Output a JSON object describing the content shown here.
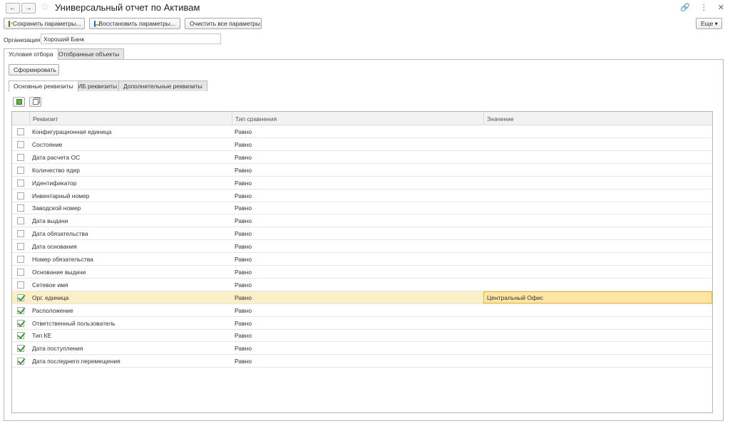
{
  "window": {
    "title": "Универсальный отчет по Активам",
    "back_glyph": "←",
    "forward_glyph": "→",
    "more_label": "Еще ▾"
  },
  "toolbar": {
    "save_label": "Сохранить параметры...",
    "restore_label": "Восстановить параметры...",
    "clear_label": "Очистить все параметры"
  },
  "organization": {
    "label": "Организация:",
    "value": "Хороший Банк"
  },
  "outer_tabs": [
    {
      "label": "Условия отбора"
    },
    {
      "label": "Отобранные объекты"
    }
  ],
  "form_button_label": "Сформировать",
  "inner_tabs": [
    {
      "label": "Основные реквизиты"
    },
    {
      "label": "ИБ реквизиты"
    },
    {
      "label": "Дополнительные реквизиты"
    }
  ],
  "table": {
    "columns": [
      "Реквизит",
      "Тип сравнения",
      "Значение"
    ],
    "rows": [
      {
        "checked": false,
        "name": "Конфигурационная единица",
        "comparison": "Равно",
        "value": ""
      },
      {
        "checked": false,
        "name": "Состояние",
        "comparison": "Равно",
        "value": ""
      },
      {
        "checked": false,
        "name": "Дата расчета ОС",
        "comparison": "Равно",
        "value": ""
      },
      {
        "checked": false,
        "name": "Количество ядер",
        "comparison": "Равно",
        "value": ""
      },
      {
        "checked": false,
        "name": "Идентификатор",
        "comparison": "Равно",
        "value": ""
      },
      {
        "checked": false,
        "name": "Инвентарный номер",
        "comparison": "Равно",
        "value": ""
      },
      {
        "checked": false,
        "name": "Заводской номер",
        "comparison": "Равно",
        "value": ""
      },
      {
        "checked": false,
        "name": "Дата выдачи",
        "comparison": "Равно",
        "value": ""
      },
      {
        "checked": false,
        "name": "Дата обязательства",
        "comparison": "Равно",
        "value": ""
      },
      {
        "checked": false,
        "name": "Дата основания",
        "comparison": "Равно",
        "value": ""
      },
      {
        "checked": false,
        "name": "Номер обязательства",
        "comparison": "Равно",
        "value": ""
      },
      {
        "checked": false,
        "name": "Основание выдачи",
        "comparison": "Равно",
        "value": ""
      },
      {
        "checked": false,
        "name": "Сетевое имя",
        "comparison": "Равно",
        "value": ""
      },
      {
        "checked": true,
        "name": "Орг. единица",
        "comparison": "Равно",
        "value": "Центральный Офис",
        "selected": true
      },
      {
        "checked": true,
        "name": "Расположение",
        "comparison": "Равно",
        "value": ""
      },
      {
        "checked": true,
        "name": "Ответственный пользователь",
        "comparison": "Равно",
        "value": ""
      },
      {
        "checked": true,
        "name": "Тип КЕ",
        "comparison": "Равно",
        "value": ""
      },
      {
        "checked": true,
        "name": "Дата поступления",
        "comparison": "Равно",
        "value": ""
      },
      {
        "checked": true,
        "name": "Дата последнего перемещения",
        "comparison": "Равно",
        "value": ""
      }
    ]
  }
}
